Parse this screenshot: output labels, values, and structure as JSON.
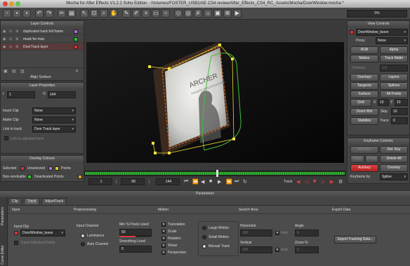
{
  "window": {
    "title": "Mocha for After Effects V1.2.2 Soho Edition - /Volumes/FOSTER_USB2/AE CS4 review/After_Effects_CS4_RC_Assets/Mocha/DoorWindow.mocha *"
  },
  "toolbar": {
    "zoom_readout": "0%"
  },
  "layer_controls": {
    "title": "Layer Controls",
    "layers": [
      {
        "name": "duplicated track full frame",
        "color": "#a070d0"
      },
      {
        "name": "mask for man",
        "color": "#30c030"
      },
      {
        "name": "DoorTrack layer",
        "color": "#e03030"
      }
    ],
    "align_surface": "Align Surface"
  },
  "layer_properties": {
    "title": "Layer Properties",
    "in_value": "1",
    "out_value": "144",
    "insert_clip_label": "Insert Clip",
    "insert_clip_value": "None",
    "matte_clip_label": "Matte Clip",
    "matte_clip_value": "None",
    "link_to_track_label": "Link to track",
    "link_to_track_value": "Door Track layer",
    "link_adjusted_label": "Link to adjusted track"
  },
  "overlay_colours": {
    "title": "Overlay Colours",
    "selected": "Selected",
    "unselected": "Unselected",
    "points": "Points",
    "non_rendeable": "Non-rendeable",
    "deactivated_points": "Deactivated Points",
    "colors": {
      "selected": "#e03030",
      "unselected": "#b070d0",
      "points": "#e0d020",
      "non_rendeable": "#30c030",
      "deactivated": "#e0a020"
    }
  },
  "viewer_controls": {
    "title": "View Controls",
    "clip_value": "DoorWindow_leave",
    "proxy_label": "Proxy",
    "proxy_value": "None",
    "rgb": "RGB",
    "alpha": "Alpha",
    "mattes": "Mattes",
    "track_matte": "Track Matte",
    "contrast_label": "Contrast",
    "contrast_value": "1.0",
    "overlays": "Overlays",
    "layers": "Layers",
    "tangents": "Tangents",
    "splines": "Splines",
    "surface": "Surface",
    "all_points": "All Points",
    "grid": "Grid",
    "grid_x_label": "X",
    "grid_x": "10",
    "grid_y_label": "Y",
    "grid_y": "10",
    "zoom_win": "Zoom Win",
    "skip_label": "Skip",
    "skip_value": "10",
    "stabilize": "Stabilize",
    "trace_label": "Trace",
    "trace_value": "0"
  },
  "keyframe_controls": {
    "title": "Keyframe Controls",
    "add_key": "Add Key",
    "del_key": "Del. Key",
    "delete_all": "Delete All",
    "copy": "Copy",
    "paste": "Paste",
    "autokey": "Autokey",
    "overkey": "Overkey",
    "keyframe_by_label": "Keyframe by",
    "keyframe_by_value": "Spline"
  },
  "timeline": {
    "start": "1",
    "current": "68",
    "end": "144",
    "track_label": "Track",
    "progress": 0.51
  },
  "parameters": {
    "title": "Parameters",
    "side_tabs": [
      "Parameters",
      "Curve Editor"
    ],
    "tabs": [
      "Clip",
      "Track",
      "AdjustTrack"
    ],
    "input_header": "Input",
    "preprocessing_header": "Preprocessing",
    "motion_header": "Motion",
    "search_area_header": "Search Area",
    "export_header": "Export Data",
    "input_clip_label": "Input Clip",
    "input_clip_value": "DoorWindow_leave",
    "track_individual_fields": "Track Individual Fields",
    "input_channel_label": "Input Channel",
    "luminance": "Luminance",
    "auto_channel": "Auto Channel",
    "min_pixels_label": "Min % Pixels Used",
    "min_pixels_value": "50",
    "smoothing_label": "Smoothing Level",
    "smoothing_value": "0",
    "translation": "Translation",
    "scale": "Scale",
    "rotation": "Rotation",
    "shear": "Shear",
    "perspective": "Perspective",
    "large_motion": "Large Motion",
    "small_motion": "Small Motion",
    "manual_track": "Manual Track",
    "horizontal_label": "Horizontal",
    "horizontal_value": "100",
    "vertical_label": "Vertical",
    "vertical_value": "100",
    "auto": "Auto",
    "angle_label": "Angle",
    "angle_value": "0",
    "zoom_label": "Zoom %",
    "zoom_value": "0",
    "export_button": "Export Tracking Data..."
  },
  "viewer_image": {
    "poster_text": "ARCHER",
    "poster_subtext": "PRIVATE INVESTIGATIONS"
  }
}
